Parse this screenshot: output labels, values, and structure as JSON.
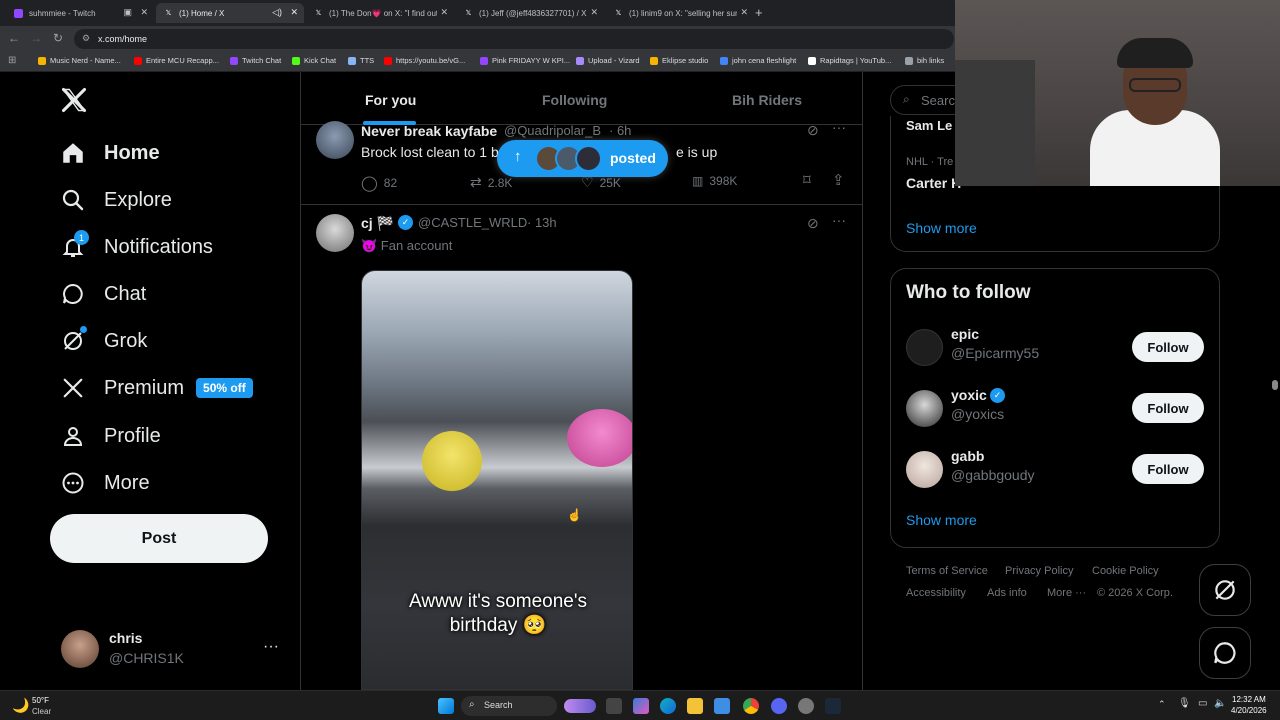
{
  "browser": {
    "tabs": [
      {
        "title": "suhmmiee - Twitch",
        "color": "#9146ff"
      },
      {
        "title": "(1) Home / X",
        "color": "#ffffff"
      },
      {
        "title": "(1) The Don💗 on X: \"I find out",
        "color": "#ffffff"
      },
      {
        "title": "(1) Jeff (@jeff4836327701) / X",
        "color": "#ffffff"
      },
      {
        "title": "(1) linim9 on X: \"selling her sun",
        "color": "#ffffff"
      }
    ],
    "url": "x.com/home",
    "bookmarks": [
      {
        "label": "Music Nerd - Name...",
        "color": "#f4b400"
      },
      {
        "label": "Entire MCU Recapp...",
        "color": "#ff0000"
      },
      {
        "label": "Twitch Chat",
        "color": "#9146ff"
      },
      {
        "label": "Kick Chat",
        "color": "#53fc18"
      },
      {
        "label": "TTS",
        "color": "#8ab4f8"
      },
      {
        "label": "https://youtu.be/vG...",
        "color": "#ff0000"
      },
      {
        "label": "Pink FRIDAYY W KPI...",
        "color": "#9146ff"
      },
      {
        "label": "Upload - Vizard",
        "color": "#a78bfa"
      },
      {
        "label": "Eklipse studio",
        "color": "#f4b400"
      },
      {
        "label": "john cena fleshlight",
        "color": "#4285f4"
      },
      {
        "label": "Rapidtags | YouTub...",
        "color": "#ffffff"
      },
      {
        "label": "bih links",
        "color": "#9aa0a6"
      }
    ]
  },
  "sidebar": {
    "items": [
      {
        "label": "Home",
        "icon": "home-icon"
      },
      {
        "label": "Explore",
        "icon": "search-icon"
      },
      {
        "label": "Notifications",
        "icon": "bell-icon",
        "badge": "1"
      },
      {
        "label": "Chat",
        "icon": "chat-icon"
      },
      {
        "label": "Grok",
        "icon": "grok-icon"
      },
      {
        "label": "Premium",
        "icon": "x-icon",
        "badge": "50% off"
      },
      {
        "label": "Profile",
        "icon": "person-icon"
      },
      {
        "label": "More",
        "icon": "more-circle-icon"
      }
    ],
    "post_label": "Post",
    "account": {
      "name": "chris",
      "handle": "@CHRIS1K"
    }
  },
  "feed": {
    "tabs": [
      "For you",
      "Following",
      "Bih Riders"
    ],
    "posted_pill": "posted",
    "tweet1": {
      "author": "Never break kayfabe",
      "handle": "@Quadripolar_B",
      "time": "· 6h",
      "text_left": "Brock lost clean to 1 b",
      "text_right": "e is up",
      "replies": "82",
      "reposts": "2.8K",
      "likes": "25K",
      "views": "398K"
    },
    "tweet2": {
      "author": "cj 🏁",
      "handle": "@CASTLE_WRLD",
      "time": "· 13h",
      "label": "😈 Fan account",
      "caption": "Awww it's someone's birthday 🥺"
    }
  },
  "right": {
    "search_placeholder": "Searc",
    "trend_partial": "Sam Le",
    "trend_meta": "NHL · Tre",
    "trend_name": "Carter H",
    "show_more": "Show more",
    "who_to_follow": "Who to follow",
    "follow_label": "Follow",
    "accounts": [
      {
        "name": "epic",
        "handle": "@Epicarmy55",
        "verified": false
      },
      {
        "name": "yoxic",
        "handle": "@yoxics",
        "verified": true
      },
      {
        "name": "gabb",
        "handle": "@gabbgoudy",
        "verified": false
      }
    ],
    "footer": [
      "Terms of Service",
      "Privacy Policy",
      "Cookie Policy",
      "Accessibility",
      "Ads info",
      "More ···",
      "© 2026 X Corp."
    ]
  },
  "taskbar": {
    "weather_temp": "50°F",
    "weather_desc": "Clear",
    "search": "Search",
    "time": "12:32 AM",
    "date": "4/20/2026"
  },
  "colors": {
    "accent": "#1d9bf0",
    "background": "#000000",
    "border": "#2f3336"
  }
}
